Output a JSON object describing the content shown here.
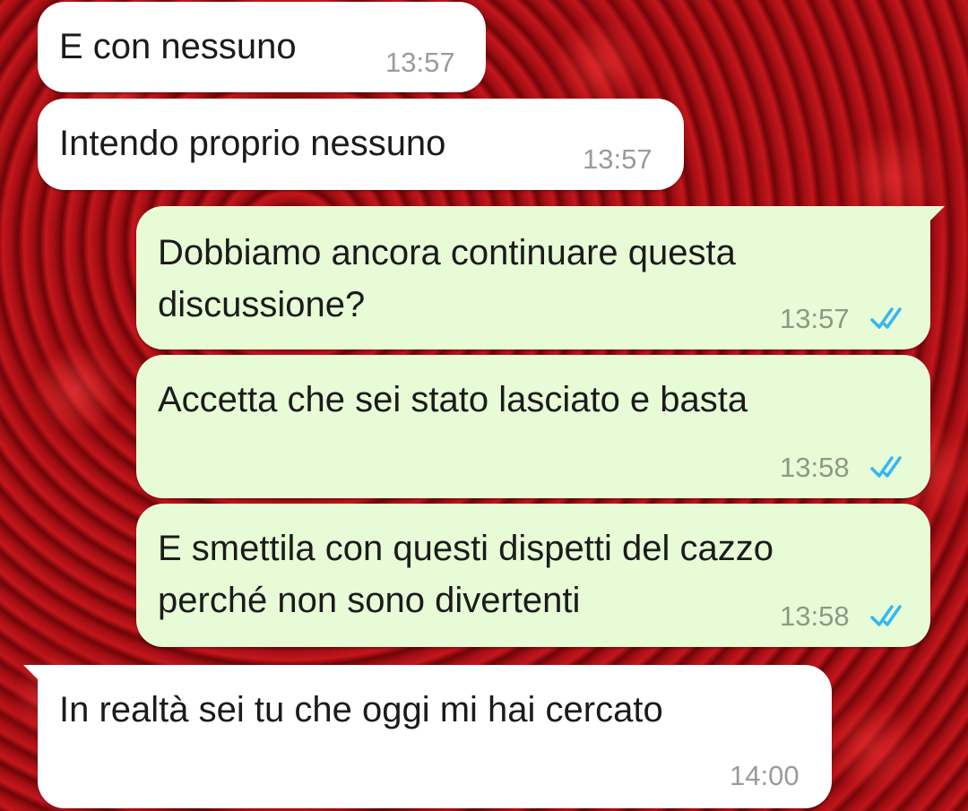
{
  "messages": [
    {
      "direction": "incoming",
      "text": "E con nessuno",
      "time": "13:57"
    },
    {
      "direction": "incoming",
      "text": "Intendo proprio nessuno",
      "time": "13:57"
    },
    {
      "direction": "outgoing",
      "lines": [
        "Dobbiamo ancora continuare questa",
        "discussione?"
      ],
      "time": "13:57",
      "status": "read"
    },
    {
      "direction": "outgoing",
      "text": "Accetta che sei stato lasciato e basta",
      "time": "13:58",
      "status": "read"
    },
    {
      "direction": "outgoing",
      "lines": [
        "E smettila con questi dispetti del cazzo",
        "perché non sono divertenti"
      ],
      "time": "13:58",
      "status": "read"
    },
    {
      "direction": "incoming",
      "text": "In realtà sei tu che oggi mi hai cercato",
      "time": "14:00"
    }
  ],
  "colors": {
    "incoming_bubble": "#ffffff",
    "outgoing_bubble": "#e7fcd6",
    "read_tick": "#34b7f1",
    "wallpaper": "#b3141a"
  },
  "icons": {
    "read_status": "double-check-icon"
  }
}
